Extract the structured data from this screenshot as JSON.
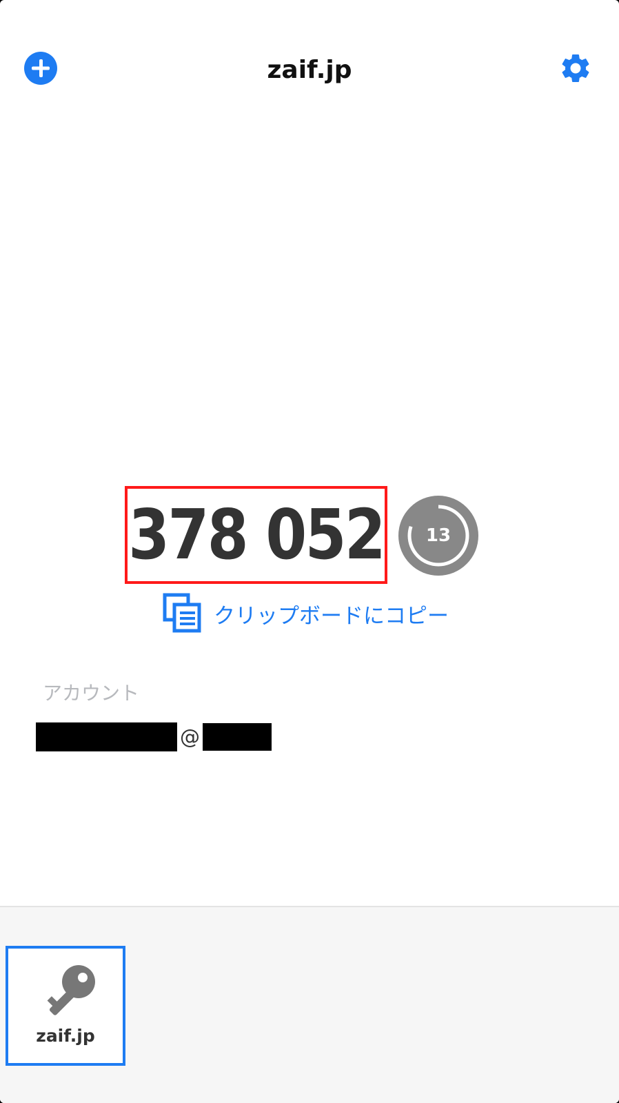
{
  "header": {
    "title": "zaif.jp"
  },
  "otp": {
    "code": "378 052",
    "seconds_remaining": "13",
    "remaining_fraction": 0.8
  },
  "copy": {
    "label": "クリップボードにコピー"
  },
  "account": {
    "label": "アカウント",
    "at": "@"
  },
  "services": [
    {
      "name": "zaif.jp"
    }
  ],
  "colors": {
    "accent": "#1e7cf2",
    "highlight": "#ff1a1a",
    "timer": "#888888"
  }
}
